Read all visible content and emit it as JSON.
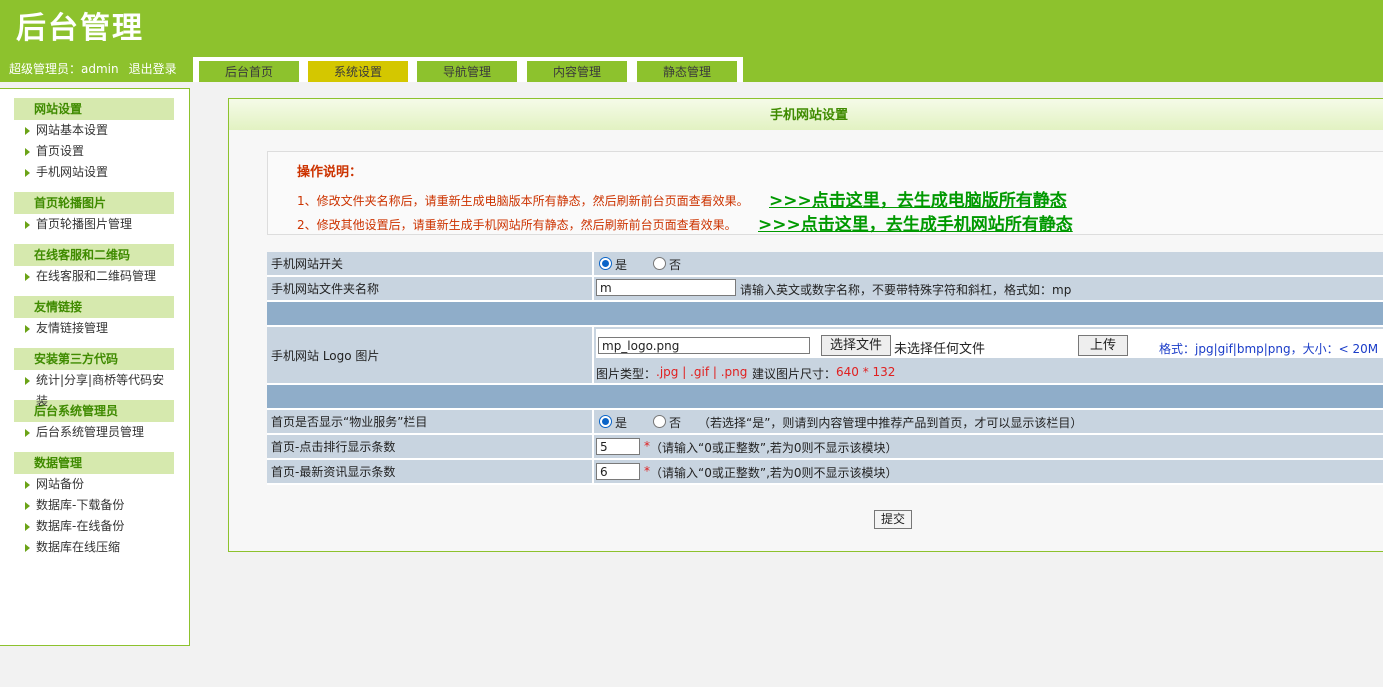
{
  "header": {
    "logo_text": "后台管理",
    "admin_label": "超级管理员：admin",
    "logout": "退出登录"
  },
  "tabs": [
    {
      "label": "后台首页"
    },
    {
      "label": "系统设置",
      "active": true
    },
    {
      "label": "导航管理"
    },
    {
      "label": "内容管理"
    },
    {
      "label": "静态管理"
    }
  ],
  "sidebar": {
    "groups": [
      {
        "title": "网站设置",
        "items": [
          "网站基本设置",
          "首页设置",
          "手机网站设置"
        ]
      },
      {
        "title": "首页轮播图片",
        "items": [
          "首页轮播图片管理"
        ]
      },
      {
        "title": "在线客服和二维码",
        "items": [
          "在线客服和二维码管理"
        ]
      },
      {
        "title": "友情链接",
        "items": [
          "友情链接管理"
        ]
      },
      {
        "title": "安装第三方代码",
        "items": [
          "统计|分享|商桥等代码安装"
        ]
      },
      {
        "title": "后台系统管理员",
        "items": [
          "后台系统管理员管理"
        ]
      },
      {
        "title": "数据管理",
        "items": [
          "网站备份",
          "数据库-下载备份",
          "数据库-在线备份",
          "数据库在线压缩"
        ]
      }
    ]
  },
  "panel": {
    "title": "手机网站设置",
    "notes_title": "操作说明：",
    "note1": "1、修改文件夹名称后，请重新生成电脑版本所有静态，然后刷新前台页面查看效果。",
    "note2": "2、修改其他设置后，请重新生成手机网站所有静态，然后刷新前台页面查看效果。",
    "link1": ">>>点击这里，去生成电脑版所有静态",
    "link2": ">>>点击这里，去生成手机网站所有静态"
  },
  "form": {
    "switch_label": "手机网站开关",
    "yes": "是",
    "no": "否",
    "folder_label": "手机网站文件夹名称",
    "folder_value": "m",
    "folder_hint": "请输入英文或数字名称，不要带特殊字符和斜杠，格式如：mp",
    "logo_label": "手机网站 Logo 图片",
    "logo_value": "mp_logo.png",
    "choose_file": "选择文件",
    "no_file": "未选择任何文件",
    "upload": "上传",
    "format_hint": "格式：jpg|gif|bmp|png，大小：< 20M",
    "type_label": "图片类型：",
    "type_value": ".jpg | .gif | .png",
    "size_label": "建议图片尺寸：",
    "size_value": "640 * 132",
    "service_label": "首页是否显示“物业服务”栏目",
    "service_hint": "（若选择“是”，则请到内容管理中推荐产品到首页，才可以显示该栏目）",
    "rank_label": "首页-点击排行显示条数",
    "rank_value": "5",
    "news_label": "首页-最新资讯显示条数",
    "news_value": "6",
    "star": "*",
    "count_hint": "（请输入“0或正整数”,若为0则不显示该模块）",
    "submit": "提交"
  },
  "colors": {
    "brand_green": "#8dc22d",
    "active_tab": "#d4c700",
    "note_red": "#cc3300",
    "link_green": "#009900"
  }
}
